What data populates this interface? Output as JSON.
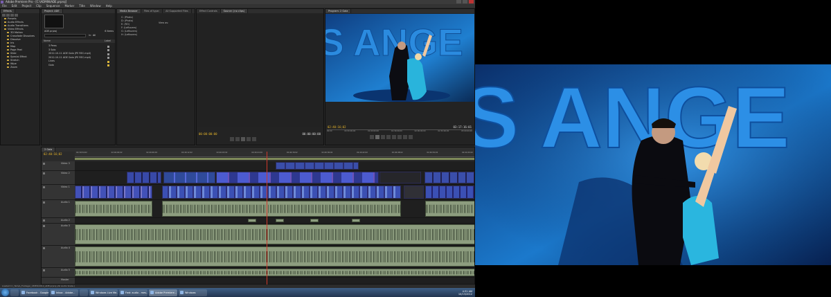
{
  "app": {
    "title": "Adobe Premiere Pro - [C:\\ADMIN\\ADE.prproj]",
    "menu": [
      "File",
      "Edit",
      "Project",
      "Clip",
      "Sequence",
      "Marker",
      "Title",
      "Window",
      "Help"
    ]
  },
  "effects_panel": {
    "tabs": [
      "Effects"
    ],
    "items": [
      {
        "label": "Presets",
        "type": "folder"
      },
      {
        "label": "Audio Effects",
        "type": "folder"
      },
      {
        "label": "Audio Transitions",
        "type": "folder"
      },
      {
        "label": "Video Effects",
        "type": "folder"
      },
      {
        "label": "3D Motion",
        "type": "sub"
      },
      {
        "label": "Crossfade Dissolves",
        "type": "sub"
      },
      {
        "label": "Dissolve",
        "type": "sub"
      },
      {
        "label": "Iris",
        "type": "sub"
      },
      {
        "label": "Map",
        "type": "sub"
      },
      {
        "label": "Page Peel",
        "type": "sub"
      },
      {
        "label": "Slide",
        "type": "sub"
      },
      {
        "label": "Special Effect",
        "type": "sub"
      },
      {
        "label": "Stretch",
        "type": "sub"
      },
      {
        "label": "Wipe",
        "type": "sub"
      },
      {
        "label": "Zoom",
        "type": "sub"
      }
    ]
  },
  "project_panel": {
    "tabs": [
      "Project: ADE"
    ],
    "project_name": "ADE.prproj",
    "items_count": "6 Items",
    "search_label": "In:",
    "search_value": "All",
    "col_name": "Name",
    "col_label": "Label",
    "rows": [
      {
        "label": "3 Pews",
        "color": "gray"
      },
      {
        "label": "3 Solo",
        "color": "gray"
      },
      {
        "label": "2012-10-11 ADE Gala (PE REC.mp4)",
        "color": "gray"
      },
      {
        "label": "2012-10-11 ADE Gala (PE REC.mp4)",
        "color": "gray"
      },
      {
        "label": "Lines",
        "color": "yellow"
      },
      {
        "label": "Gala",
        "color": "yellow"
      }
    ]
  },
  "media_browser": {
    "tabs": [
      "Media Browser",
      "Files of type:",
      "All Supported Files"
    ],
    "drives": [
      "C: (Photo)",
      "D: (Photo)",
      "E: (RO)",
      "F: (Leftovers)",
      "G: (Leftovers)",
      "H: (Leftovers)"
    ],
    "view_label": "View as:"
  },
  "source_panel": {
    "tabs": [
      "Effect Controls",
      "Source: (no clips)"
    ],
    "tc_left": "00:00:00:00",
    "tc_right": "00:00:00:00"
  },
  "program_panel": {
    "tabs": [
      "Program: 2 Gala"
    ],
    "tc_current": "02:40:16;02",
    "tc_duration": "03:17:16:01",
    "ruler_labels": [
      "00;00",
      "00:30:00;00",
      "01:00:00;00",
      "01:30:00;00",
      "02:00:00;00",
      "02:30:00;00",
      "03:00:00;00"
    ]
  },
  "timeline": {
    "tabs": [
      "2 Gala"
    ],
    "tc": "02:40:16;02",
    "ruler_labels": [
      "02;39;54;02",
      "02;40;00;02",
      "02;40;06;02",
      "02;40;12;02",
      "02;40;18;02",
      "02;40;24;02",
      "02;40;30;02",
      "02;40;36;02",
      "02;40;42;02",
      "02;40;48;02",
      "02;40;54;02",
      "02;41;00;02"
    ],
    "tracks": [
      {
        "label": "Video 3",
        "kind": "video"
      },
      {
        "label": "Video 2",
        "kind": "video"
      },
      {
        "label": "Video 1",
        "kind": "video"
      },
      {
        "label": "Audio 1",
        "kind": "audio"
      },
      {
        "label": "Audio 2",
        "kind": "audio"
      },
      {
        "label": "Audio 3",
        "kind": "audio"
      },
      {
        "label": "Audio 4",
        "kind": "audio"
      },
      {
        "label": "Audio 5",
        "kind": "audio"
      },
      {
        "label": "Master",
        "kind": "master"
      }
    ]
  },
  "status_bar": {
    "text": "Loaded C:\\_Temp\\_Footage\\_VIDEO\\2012_ADE.prproj (All Audio Scale.)"
  },
  "taskbar": {
    "items": [
      "Facebook - Google...",
      "Inbox - Adobe...",
      "Windows Live Me...",
      "Fwd: audio - mes...",
      "Adobe Premiere...",
      "Windows"
    ],
    "clock_time": "4:31 AM",
    "clock_date": "10/13/2012"
  },
  "program_overlay_text": "S ANGE",
  "full_screen_text": "S ANGE",
  "colors": {
    "timecode": "#e8b62a",
    "video_clip": "#4a4ac8",
    "audio_clip": "#8d9d7f",
    "playhead": "#d0392b",
    "stage_light": "#1f7fd0"
  }
}
